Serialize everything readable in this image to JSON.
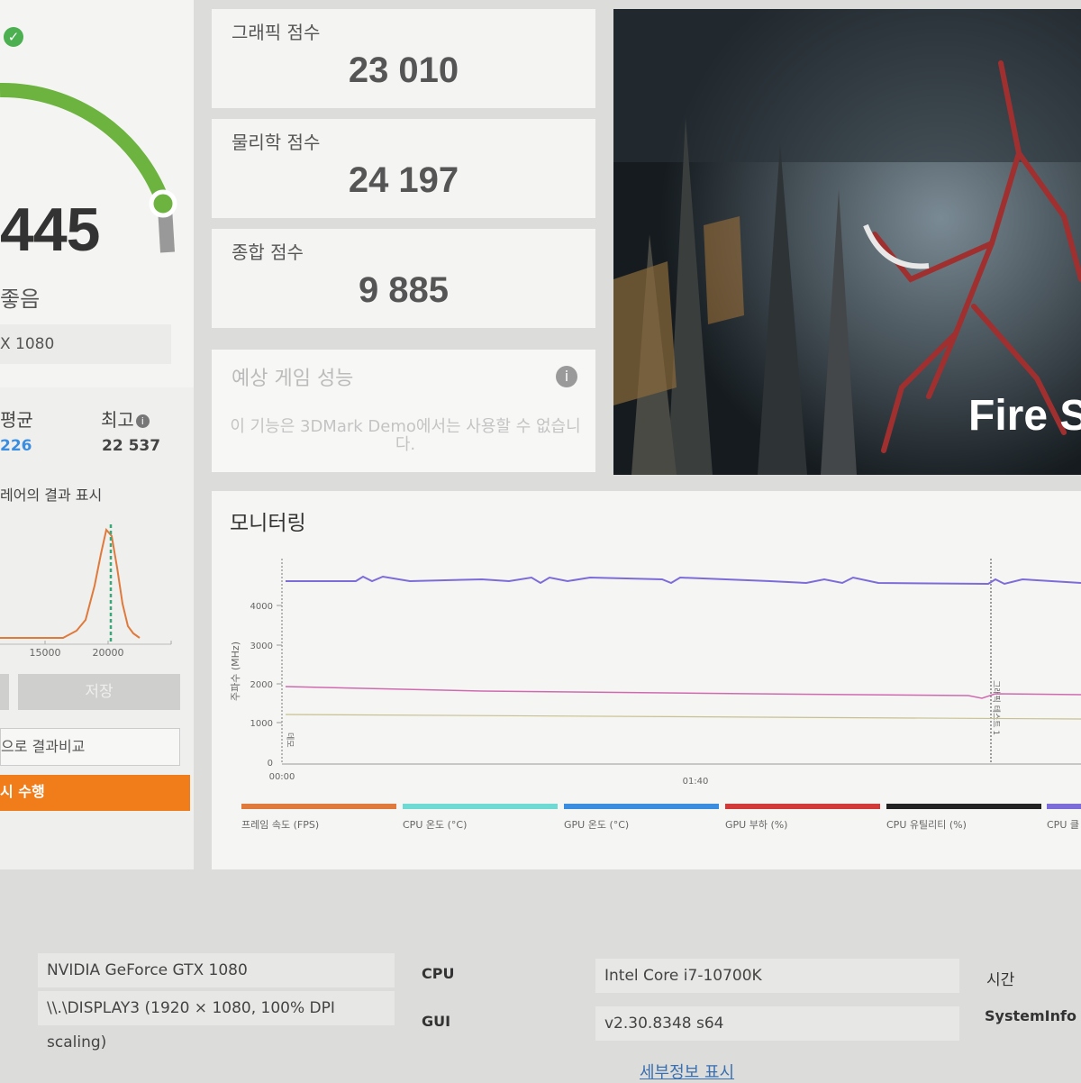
{
  "left": {
    "main_score": "445",
    "rating": "좋음",
    "gpu_name": "X 1080",
    "avg_label": "평균",
    "avg_value": "226",
    "best_label": "최고",
    "best_value": "22 537",
    "hardware_results": "레어의 결과 표시",
    "hist_ticks": [
      "15000",
      "20000"
    ],
    "save_label": "저장",
    "compare_label": "으로 결과비교",
    "run_label": "시 수행"
  },
  "scores": [
    {
      "label": "그래픽 점수",
      "value": "23 010"
    },
    {
      "label": "물리학 점수",
      "value": "24 197"
    },
    {
      "label": "종합 점수",
      "value": "9 885"
    }
  ],
  "estimated": {
    "title": "예상 게임 성능",
    "text": "이 기능은 3DMark Demo에서는 사용할 수 없습니다."
  },
  "hero": {
    "title": "Fire S"
  },
  "monitoring": {
    "title": "모니터링",
    "ylabel": "주파수 (MHz)",
    "y_ticks": [
      "4000",
      "3000",
      "2000",
      "1000",
      "0"
    ],
    "x_ticks": [
      "00:00",
      "01:40"
    ],
    "marker_labels": [
      "데모",
      "그래픽 테스트 1"
    ],
    "legend": [
      {
        "label": "프레임 속도 (FPS)",
        "color": "#e07a3c"
      },
      {
        "label": "CPU 온도 (°C)",
        "color": "#6fd9d3"
      },
      {
        "label": "GPU 온도 (°C)",
        "color": "#3b8de0"
      },
      {
        "label": "GPU 부하 (%)",
        "color": "#d23a3a"
      },
      {
        "label": "CPU 유틸리티 (%)",
        "color": "#222222"
      },
      {
        "label": "CPU 클",
        "color": "#7c6cd9"
      }
    ]
  },
  "sysinfo": {
    "gpu": "NVIDIA GeForce GTX 1080",
    "display": "\\\\.\\DISPLAY3 (1920 × 1080, 100% DPI scaling)",
    "cpu_key": "CPU",
    "cpu_value": "Intel Core i7-10700K",
    "gui_key": "GUI",
    "gui_value": "v2.30.8348 s64",
    "time_key": "시간",
    "systeminfo_key": "SystemInfo",
    "detail_link": "세부정보 표시"
  }
}
